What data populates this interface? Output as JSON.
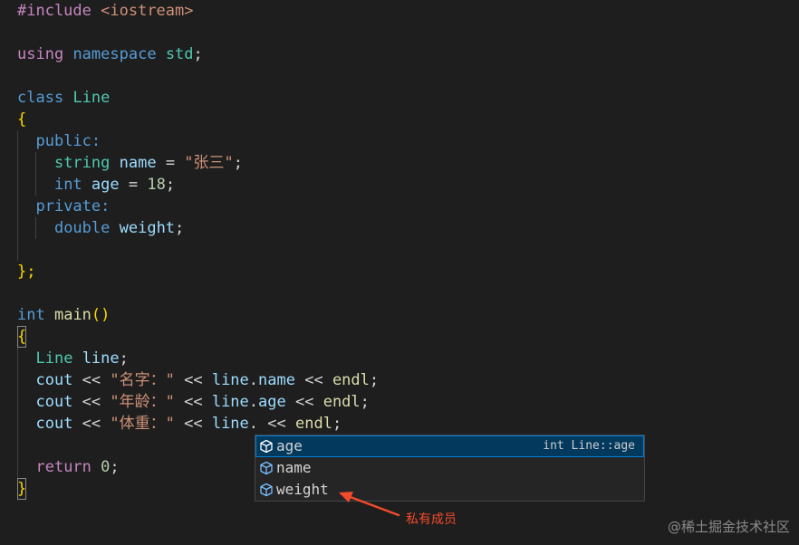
{
  "code": {
    "line_include": {
      "directive": "#include",
      "header": "<iostream>"
    },
    "line_using": {
      "kw1": "using",
      "kw2": "namespace",
      "ns": "std",
      "semi": ";"
    },
    "line_class": {
      "kw": "class",
      "name": "Line"
    },
    "open_brace": "{",
    "public_label": "public:",
    "line_name_decl": {
      "type": "string",
      "var": "name",
      "eq": " = ",
      "value": "\"张三\"",
      "semi": ";"
    },
    "line_age_decl": {
      "type": "int",
      "var": "age",
      "eq": " = ",
      "value": "18",
      "semi": ";"
    },
    "private_label": "private:",
    "line_weight_decl": {
      "type": "double",
      "var": "weight",
      "semi": ";"
    },
    "class_close": "};",
    "line_main": {
      "type": "int",
      "fn": "main",
      "parens": "()"
    },
    "main_open": "{",
    "line_obj": {
      "type": "Line",
      "var": "line",
      "semi": ";"
    },
    "cout_name": {
      "cout": "cout",
      "op1": " << ",
      "str": "\"名字：\"",
      "op2": " << ",
      "obj": "line",
      "dot": ".",
      "member": "name",
      "op3": " << ",
      "endl": "endl",
      "semi": ";"
    },
    "cout_age": {
      "cout": "cout",
      "op1": " << ",
      "str": "\"年龄：\"",
      "op2": " << ",
      "obj": "line",
      "dot": ".",
      "member": "age",
      "op3": " << ",
      "endl": "endl",
      "semi": ";"
    },
    "cout_weight": {
      "cout": "cout",
      "op1": " << ",
      "str": "\"体重：\"",
      "op2": " << ",
      "obj": "line",
      "dot": ". ",
      "op3": "<< ",
      "endl": "endl",
      "semi": ";"
    },
    "line_return": {
      "kw": "return",
      "value": "0",
      "semi": ";"
    },
    "main_close": "}"
  },
  "suggestions": {
    "items": [
      {
        "label": "age",
        "detail": "int Line::age",
        "selected": true,
        "icon": "field-cube-icon"
      },
      {
        "label": "name",
        "selected": false,
        "icon": "field-cube-icon"
      },
      {
        "label": "weight",
        "selected": false,
        "icon": "field-cube-icon"
      }
    ]
  },
  "annotation": {
    "text": "私有成员",
    "color": "#f24a2a"
  },
  "watermark": "@稀土掘金技术社区",
  "colors": {
    "background": "#1e1e1e",
    "keyword": "#569cd6",
    "preprocessor": "#c586c0",
    "type": "#4ec9b0",
    "function": "#dcdcaa",
    "variable": "#9cdcfe",
    "string": "#ce9178",
    "number": "#b5cea8",
    "bracket": "#ffd700",
    "suggest_bg": "#252526",
    "suggest_selected": "#04395e"
  }
}
